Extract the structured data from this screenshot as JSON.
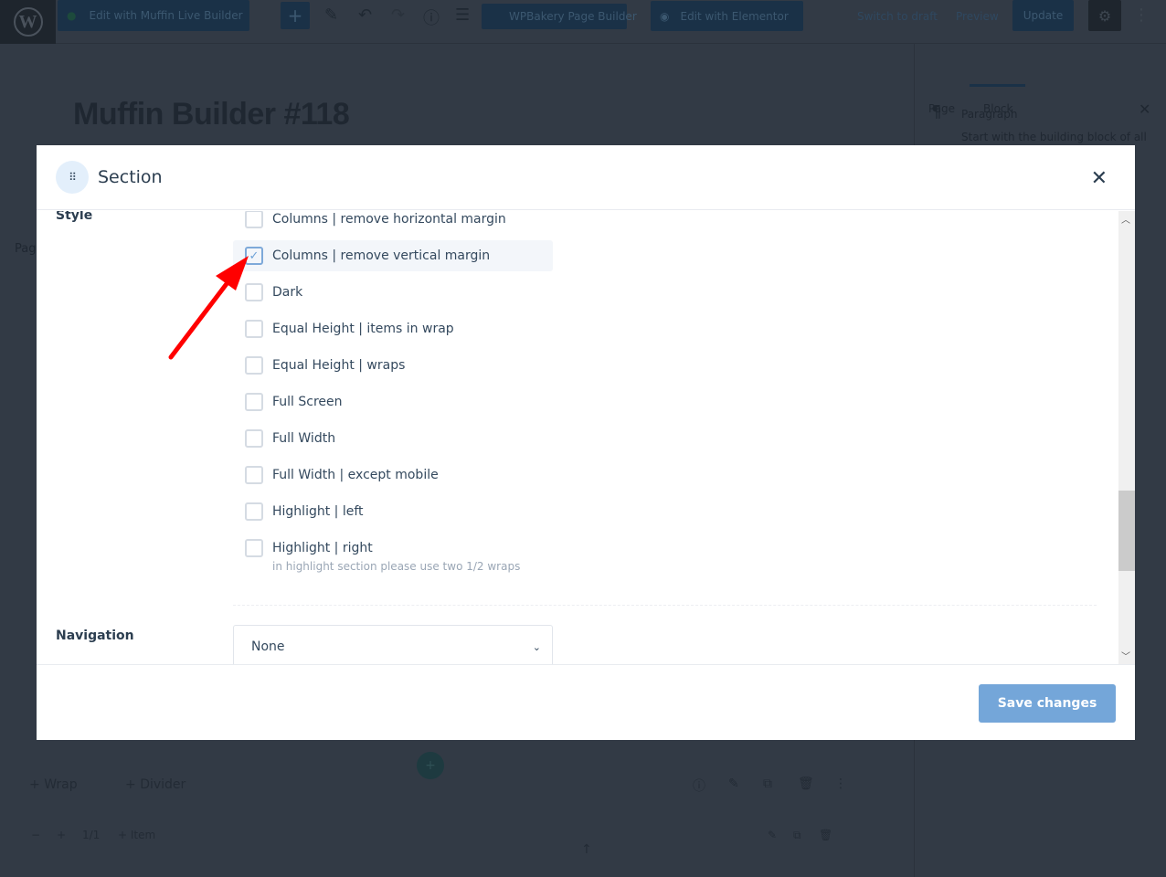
{
  "topbar": {
    "muffin_btn": "Edit with Muffin Live Builder",
    "wpbakery_btn": "WPBakery Page Builder",
    "elementor_btn": "Edit with Elementor",
    "switch_draft": "Switch to draft",
    "preview": "Preview",
    "update": "Update"
  },
  "page_title": "Muffin Builder #118",
  "sidebar": {
    "tab_page": "Page",
    "tab_block": "Block",
    "block_name": "Paragraph",
    "block_desc": "Start with the building block of all",
    "page_label": "Pag"
  },
  "bottom": {
    "wrap": "Wrap",
    "divider": "Divider",
    "size": "1/1",
    "item": "Item"
  },
  "modal": {
    "title": "Section",
    "style_label": "Style",
    "options": [
      {
        "label": "Columns | remove horizontal margin",
        "checked": false
      },
      {
        "label": "Columns | remove vertical margin",
        "checked": true
      },
      {
        "label": "Dark",
        "checked": false
      },
      {
        "label": "Equal Height | items in wrap",
        "checked": false
      },
      {
        "label": "Equal Height | wraps",
        "checked": false
      },
      {
        "label": "Full Screen",
        "checked": false
      },
      {
        "label": "Full Width",
        "checked": false
      },
      {
        "label": "Full Width | except mobile",
        "checked": false
      },
      {
        "label": "Highlight | left",
        "checked": false
      },
      {
        "label": "Highlight | right",
        "checked": false
      }
    ],
    "hint": "in highlight section please use two 1/2 wraps",
    "navigation_label": "Navigation",
    "navigation_value": "None",
    "save": "Save changes"
  },
  "colors": {
    "accent": "#74a6d9",
    "annotation_arrow": "#ff0000"
  }
}
